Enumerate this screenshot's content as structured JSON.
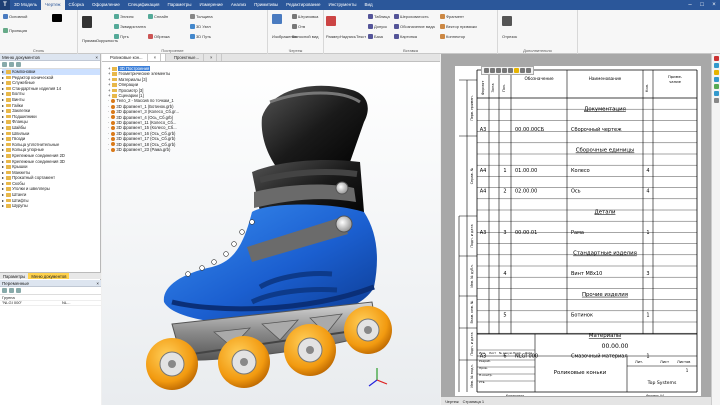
{
  "app": {
    "menu": [
      "3D Модель",
      "Чертеж",
      "Сборка",
      "Оформление",
      "Спецификация",
      "Параметры",
      "Измерение",
      "Анализ",
      "Примитивы",
      "Редактирование",
      "Инструменты",
      "Вид"
    ],
    "active_menu": 1
  },
  "ribbon": {
    "groups": [
      {
        "label": "Стиль",
        "items": [
          "Основной",
          "Проекция"
        ]
      },
      {
        "label": "Построение",
        "items": [
          "Эллипс",
          "Сплайн",
          "Эквидистанта",
          "Путь",
          "Прямая",
          "Окружность",
          "Обрезка",
          "Толщина",
          "3D Узел",
          "3D Путь"
        ]
      },
      {
        "label": "Чертеж",
        "items": [
          "Изображение",
          "Штриховка",
          "Отв",
          "Шероховатость",
          "Выносной вид"
        ]
      },
      {
        "label": "Вставка",
        "items": [
          "Размер",
          "Надпись",
          "Текст",
          "Таблица",
          "Допуск",
          "База",
          "Шероховатость",
          "Обозначение вида",
          "Картинка",
          "Фрагмент",
          "Вектор привязки",
          "Коннектор"
        ]
      },
      {
        "label": "Дополнительно",
        "items": [
          "Отрезок"
        ]
      }
    ]
  },
  "left_panel": {
    "title": "Меню документов",
    "tree": [
      {
        "label": "Компоновки",
        "selected": true
      },
      {
        "label": "Редактор конической"
      },
      {
        "label": "Служебные"
      },
      {
        "label": "Стандартные изделия 14"
      },
      {
        "label": "Болты"
      },
      {
        "label": "Винты"
      },
      {
        "label": "Гайки"
      },
      {
        "label": "Заклепки"
      },
      {
        "label": "Подшипники"
      },
      {
        "label": "Фланцы"
      },
      {
        "label": "Шайбы"
      },
      {
        "label": "Шпильки"
      },
      {
        "label": "Гвозди"
      },
      {
        "label": "Кольца уплотнительные"
      },
      {
        "label": "Кольца упорные"
      },
      {
        "label": "Крепежные соединения 2D"
      },
      {
        "label": "Крепежные соединения 3D"
      },
      {
        "label": "Крышки"
      },
      {
        "label": "Манжеты"
      },
      {
        "label": "Прокатный сортамент"
      },
      {
        "label": "Скобы"
      },
      {
        "label": "Уголки и швеллеры"
      },
      {
        "label": "Штанги"
      },
      {
        "label": "Штифты"
      },
      {
        "label": "Шурупы"
      }
    ],
    "tabs": [
      "Параметры",
      "Меню документов"
    ],
    "active_tab": 1
  },
  "vars_panel": {
    "title": "Переменные",
    "rows": [
      {
        "name": "Группа",
        "value": ""
      },
      {
        "name": "\"NLGI 000\"",
        "value": "NL..."
      }
    ]
  },
  "doc_tabs": [
    "Роликовые кон...",
    "Проектные..."
  ],
  "model_tree": [
    {
      "label": "3D Построения",
      "kind": "folder",
      "highlight": true
    },
    {
      "label": "Геометрические элементы",
      "kind": "folder"
    },
    {
      "label": "Материалы [3]",
      "kind": "folder"
    },
    {
      "label": "Операции",
      "kind": "folder"
    },
    {
      "label": "Просмотр [3]",
      "kind": "folder"
    },
    {
      "label": "Сценарии [1]",
      "kind": "folder"
    },
    {
      "label": "Тело_2 - Массив по точкам_1",
      "kind": "part"
    },
    {
      "label": "3D фрагмент_1 (Ботинок.grb)",
      "kind": "part"
    },
    {
      "label": "3D фрагмент_3 (Колесо_Сб.gr...",
      "kind": "part"
    },
    {
      "label": "3D фрагмент_4 (Ось_Сб.grb)",
      "kind": "part"
    },
    {
      "label": "3D фрагмент_11 (Колесо_Сб...",
      "kind": "part"
    },
    {
      "label": "3D фрагмент_15 (Колесо_Сб...",
      "kind": "part"
    },
    {
      "label": "3D фрагмент_16 (Ось_Сб.grb)",
      "kind": "part"
    },
    {
      "label": "3D фрагмент_17 (Ось_Сб.grb)",
      "kind": "part"
    },
    {
      "label": "3D фрагмент_18 (Ось_Сб.grb)",
      "kind": "part"
    },
    {
      "label": "3D фрагмент_23 (Рама.grb)",
      "kind": "part"
    }
  ],
  "spec": {
    "headers": {
      "format": "Формат",
      "zone": "Зона",
      "pos": "Поз.",
      "designation": "Обозначение",
      "name": "Наименование",
      "qty": "Кол.",
      "note": "Приме-\nчание"
    },
    "rows": [
      {
        "format": "",
        "zone": "",
        "pos": "",
        "designation": "",
        "name": "Документация",
        "qty": "",
        "section": true
      },
      {
        "format": "А3",
        "zone": "",
        "pos": "",
        "designation": "00.00.00СБ",
        "name": "Сборочный чертеж",
        "qty": ""
      },
      {
        "format": "",
        "zone": "",
        "pos": "",
        "designation": "",
        "name": "Сборочные единицы",
        "qty": "",
        "section": true
      },
      {
        "format": "А4",
        "zone": "",
        "pos": "1",
        "designation": "01.00.00",
        "name": "Колесо",
        "qty": "4"
      },
      {
        "format": "А4",
        "zone": "",
        "pos": "2",
        "designation": "02.00.00",
        "name": "Ось",
        "qty": "4"
      },
      {
        "format": "",
        "zone": "",
        "pos": "",
        "designation": "",
        "name": "Детали",
        "qty": "",
        "section": true
      },
      {
        "format": "А3",
        "zone": "",
        "pos": "3",
        "designation": "00.00.01",
        "name": "Рама",
        "qty": "1"
      },
      {
        "format": "",
        "zone": "",
        "pos": "",
        "designation": "",
        "name": "Стандартные изделия",
        "qty": "",
        "section": true
      },
      {
        "format": "",
        "zone": "",
        "pos": "4",
        "designation": "",
        "name": "Винт М8х10",
        "qty": "3"
      },
      {
        "format": "",
        "zone": "",
        "pos": "",
        "designation": "",
        "name": "Прочие изделия",
        "qty": "",
        "section": true
      },
      {
        "format": "",
        "zone": "",
        "pos": "5",
        "designation": "",
        "name": "Ботинок",
        "qty": "1"
      },
      {
        "format": "",
        "zone": "",
        "pos": "",
        "designation": "",
        "name": "Материалы",
        "qty": "",
        "section": true
      },
      {
        "format": "А3",
        "zone": "",
        "pos": "6",
        "designation": "NLGI 000",
        "name": "Смазочный материал",
        "qty": "1"
      }
    ],
    "side_labels": [
      "Перв. примен.",
      "Справ. №",
      "Подп. и дата",
      "Инв. № дубл.",
      "Взам. инв. №",
      "Подп. и дата",
      "Инв. № подл."
    ],
    "title_block": {
      "code": "00.00.00",
      "title": "Роликовые коньки",
      "company": "Top Systems",
      "row_labels": [
        "Изм.",
        "Лист",
        "№ докум.",
        "Подп.",
        "Дата"
      ],
      "people": [
        "Разраб.",
        "Пров.",
        "Н.контр.",
        "Утв."
      ],
      "lit": "Лит.",
      "sheet": "Лист",
      "sheets": "Листов",
      "sheets_count": "1",
      "copied": "Копировал",
      "format": "Формат А4"
    }
  },
  "status": {
    "tabs": [
      "Чертеж",
      "Страница 1"
    ]
  }
}
